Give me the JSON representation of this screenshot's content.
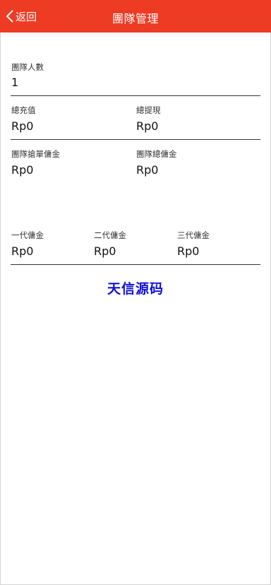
{
  "header": {
    "back_label": "返回",
    "title": "團隊管理",
    "accent_color": "#ee3b23"
  },
  "team": {
    "count_label": "團隊人數",
    "count_value": "1",
    "total_recharge_label": "總充值",
    "total_recharge_value": "Rp0",
    "total_withdraw_label": "總提現",
    "total_withdraw_value": "Rp0",
    "grab_commission_label": "團隊搶單傭金",
    "grab_commission_value": "Rp0",
    "total_commission_label": "團隊總傭金",
    "total_commission_value": "Rp0"
  },
  "levels": [
    {
      "label": "一代傭金",
      "value": "Rp0"
    },
    {
      "label": "二代傭金",
      "value": "Rp0"
    },
    {
      "label": "三代傭金",
      "value": "Rp0"
    }
  ],
  "watermark": "天信源码"
}
